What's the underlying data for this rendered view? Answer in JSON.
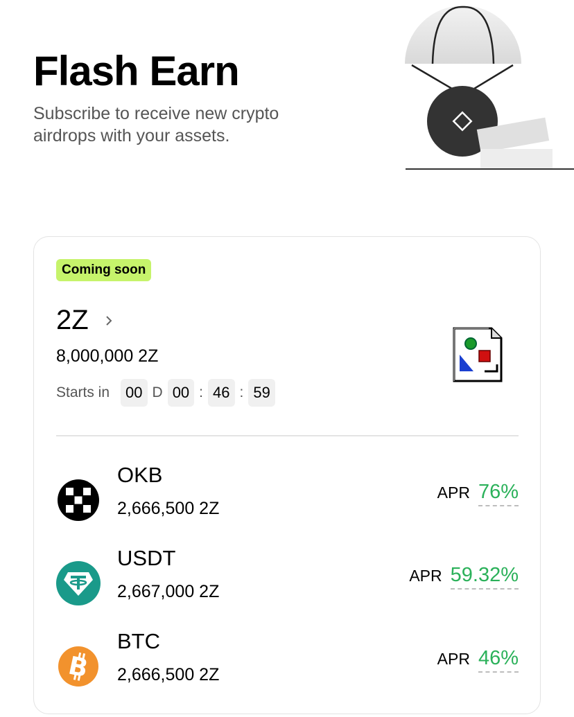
{
  "hero": {
    "title": "Flash Earn",
    "subtitle": "Subscribe to receive new crypto airdrops with your assets."
  },
  "project": {
    "badge": "Coming soon",
    "name": "2Z",
    "total_amount": "8,000,000 2Z",
    "starts_label": "Starts in",
    "countdown": {
      "days": "00",
      "days_unit": "D",
      "hours": "00",
      "minutes": "46",
      "seconds": "59",
      "separator": ":"
    }
  },
  "pools": [
    {
      "coin": "OKB",
      "amount": "2,666,500 2Z",
      "apr_label": "APR",
      "apr": "76%",
      "icon": "okb-icon",
      "color": "#000000"
    },
    {
      "coin": "USDT",
      "amount": "2,667,000 2Z",
      "apr_label": "APR",
      "apr": "59.32%",
      "icon": "usdt-icon",
      "color": "#1a9a8a"
    },
    {
      "coin": "BTC",
      "amount": "2,666,500 2Z",
      "apr_label": "APR",
      "apr": "46%",
      "icon": "btc-icon",
      "color": "#f2922d"
    }
  ],
  "colors": {
    "badge": "#c6f36b",
    "apr_green": "#2bb15a",
    "border": "#e3e3e3"
  }
}
